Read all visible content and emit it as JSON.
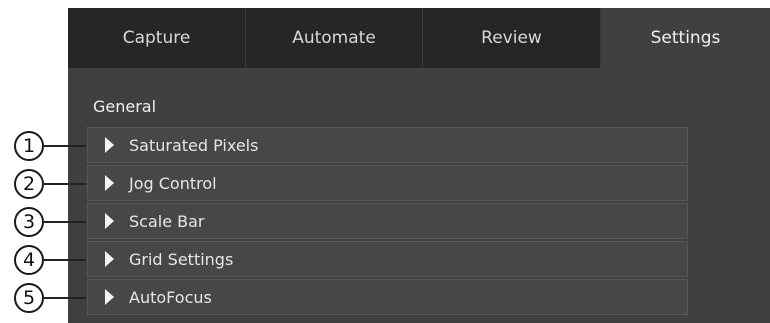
{
  "tabs": [
    {
      "label": "Capture",
      "active": false
    },
    {
      "label": "Automate",
      "active": false
    },
    {
      "label": "Review",
      "active": false
    },
    {
      "label": "Settings",
      "active": true
    }
  ],
  "section": {
    "title": "General"
  },
  "items": [
    {
      "label": "Saturated Pixels",
      "callout": "1",
      "expanded": false
    },
    {
      "label": "Jog Control",
      "callout": "2",
      "expanded": false
    },
    {
      "label": "Scale Bar",
      "callout": "3",
      "expanded": false
    },
    {
      "label": "Grid Settings",
      "callout": "4",
      "expanded": false
    },
    {
      "label": "AutoFocus",
      "callout": "5",
      "expanded": false
    }
  ],
  "icons": {
    "expander": "caret-right-icon"
  },
  "colors": {
    "panel_bg": "#404040",
    "tabbar_bg": "#262626",
    "row_bg": "#474747",
    "text": "#e6e6e6"
  }
}
